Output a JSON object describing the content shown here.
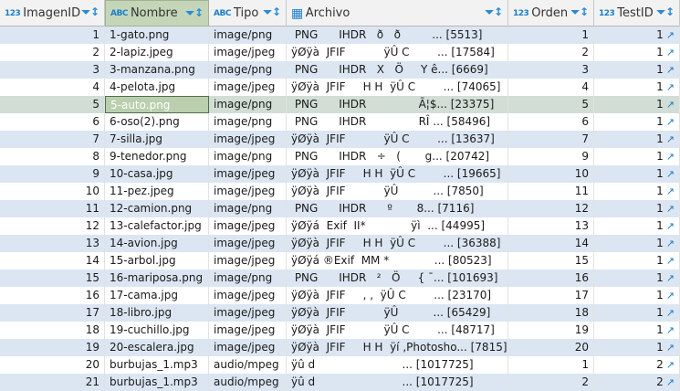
{
  "columns": [
    {
      "label": "ImagenID",
      "type_icon": "123"
    },
    {
      "label": "Nombre",
      "type_icon": "ABC"
    },
    {
      "label": "Tipo",
      "type_icon": "ABC"
    },
    {
      "label": "Archivo",
      "type_icon": "▦"
    },
    {
      "label": "Orden",
      "type_icon": "123"
    },
    {
      "label": "TestID",
      "type_icon": "123"
    }
  ],
  "selected_row": 5,
  "rows": [
    [
      "1",
      "1-gato.png",
      "image/png",
      " PNG      IHDR   ð   ð         ... [5513]",
      "1",
      "1"
    ],
    [
      "2",
      "2-lapiz.jpeg",
      "image/jpeg",
      "ÿØÿà  JFIF           ÿÛ C        ... [17584]",
      "2",
      "1"
    ],
    [
      "3",
      "3-manzana.png",
      "image/png",
      " PNG      IHDR   X   Ö     Y ê... [6669]",
      "3",
      "1"
    ],
    [
      "4",
      "4-pelota.jpg",
      "image/jpeg",
      "ÿØÿà  JFIF     H H  ÿÛ C        ... [74065]",
      "4",
      "1"
    ],
    [
      "5",
      "5-auto.png",
      "image/png",
      " PNG      IHDR               Ã¦$... [23375]",
      "5",
      "1"
    ],
    [
      "6",
      "6-oso(2).png",
      "image/png",
      " PNG      IHDR               RÎ ... [58496]",
      "6",
      "1"
    ],
    [
      "7",
      "7-silla.jpg",
      "image/jpeg",
      "ÿØÿà  JFIF           ÿÛ C        ... [13637]",
      "7",
      "1"
    ],
    [
      "8",
      "9-tenedor.png",
      "image/png",
      " PNG      IHDR   ÷   (       g... [20742]",
      "9",
      "1"
    ],
    [
      "9",
      "10-casa.jpg",
      "image/jpeg",
      "ÿØÿà  JFIF     H H  ÿÛ C        ... [19665]",
      "10",
      "1"
    ],
    [
      "10",
      "11-pez.jpeg",
      "image/jpeg",
      "ÿØÿà  JFIF           ÿÛ          ... [7850]",
      "11",
      "1"
    ],
    [
      "11",
      "12-camion.png",
      "image/png",
      " PNG      IHDR      º       8... [7116]",
      "12",
      "1"
    ],
    [
      "12",
      "13-calefactor.jpg",
      "image/jpeg",
      "ÿØÿá  Exif  II*             ÿì  ... [44995]",
      "13",
      "1"
    ],
    [
      "13",
      "14-avion.jpg",
      "image/jpeg",
      "ÿØÿà  JFIF     H H  ÿÛ C        ... [36388]",
      "14",
      "1"
    ],
    [
      "14",
      "15-arbol.jpg",
      "image/jpeg",
      "ÿØÿá ®Exif  MM *             ... [80523]",
      "15",
      "1"
    ],
    [
      "15",
      "16-mariposa.png",
      "image/png",
      " PNG      IHDR   ²   Ö     { ¯... [101693]",
      "16",
      "1"
    ],
    [
      "16",
      "17-cama.jpg",
      "image/jpeg",
      "ÿØÿà  JFIF     , ,  ÿÛ C        ... [23170]",
      "17",
      "1"
    ],
    [
      "17",
      "18-libro.jpg",
      "image/jpeg",
      "ÿØÿà  JFIF           ÿÛ          ... [65429]",
      "18",
      "1"
    ],
    [
      "18",
      "19-cuchillo.jpg",
      "image/jpeg",
      "ÿØÿà  JFIF           ÿÛ C        ... [48717]",
      "19",
      "1"
    ],
    [
      "19",
      "20-escalera.jpg",
      "image/jpeg",
      "ÿØÿà  JFIF     H H  ÿí ,Photosho... [7815]",
      "20",
      "1"
    ],
    [
      "20",
      "burbujas_1.mp3",
      "audio/mpeg",
      "ÿû d                         ... [1017725]",
      "1",
      "2"
    ],
    [
      "21",
      "burbujas_1.mp3",
      "audio/mpeg",
      "ÿû d                         ... [1017725]",
      "2",
      "2"
    ]
  ]
}
